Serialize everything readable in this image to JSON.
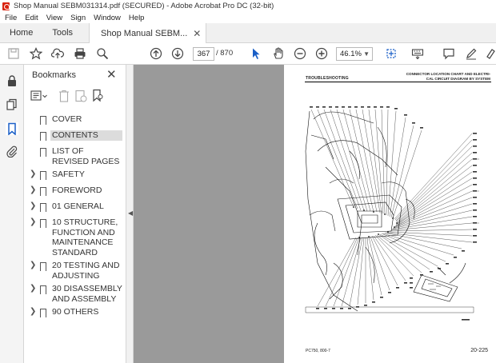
{
  "window": {
    "title": "Shop Manual SEBM031314.pdf (SECURED) - Adobe Acrobat Pro DC (32-bit)"
  },
  "menu": [
    "File",
    "Edit",
    "View",
    "Sign",
    "Window",
    "Help"
  ],
  "tabs": {
    "home": "Home",
    "tools": "Tools",
    "document": "Shop Manual SEBM..."
  },
  "toolbar": {
    "current_page": "367",
    "total_pages": "/ 870",
    "zoom": "46.1%"
  },
  "bookmarks": {
    "title": "Bookmarks",
    "items": [
      {
        "label": "COVER",
        "expandable": false
      },
      {
        "label": "CONTENTS",
        "expandable": false,
        "selected": true
      },
      {
        "label": "LIST OF REVISED PAGES",
        "expandable": false
      },
      {
        "label": "SAFETY",
        "expandable": true
      },
      {
        "label": "FOREWORD",
        "expandable": true
      },
      {
        "label": "01 GENERAL",
        "expandable": true
      },
      {
        "label": "10 STRUCTURE, FUNCTION AND MAINTENANCE STANDARD",
        "expandable": true
      },
      {
        "label": "20 TESTING AND ADJUSTING",
        "expandable": true
      },
      {
        "label": "30 DISASSEMBLY AND ASSEMBLY",
        "expandable": true
      },
      {
        "label": "90 OTHERS",
        "expandable": true
      }
    ]
  },
  "pdf_page": {
    "header_left": "TROUBLESHOOTING",
    "header_right_1": "CONNECTOR LOCATION CHART AND ELECTRI-",
    "header_right_2": "CAL CIRCUIT DIAGRAM BY SYSTEM",
    "footer_left": "PC750, 800-7",
    "footer_right": "20-225"
  }
}
